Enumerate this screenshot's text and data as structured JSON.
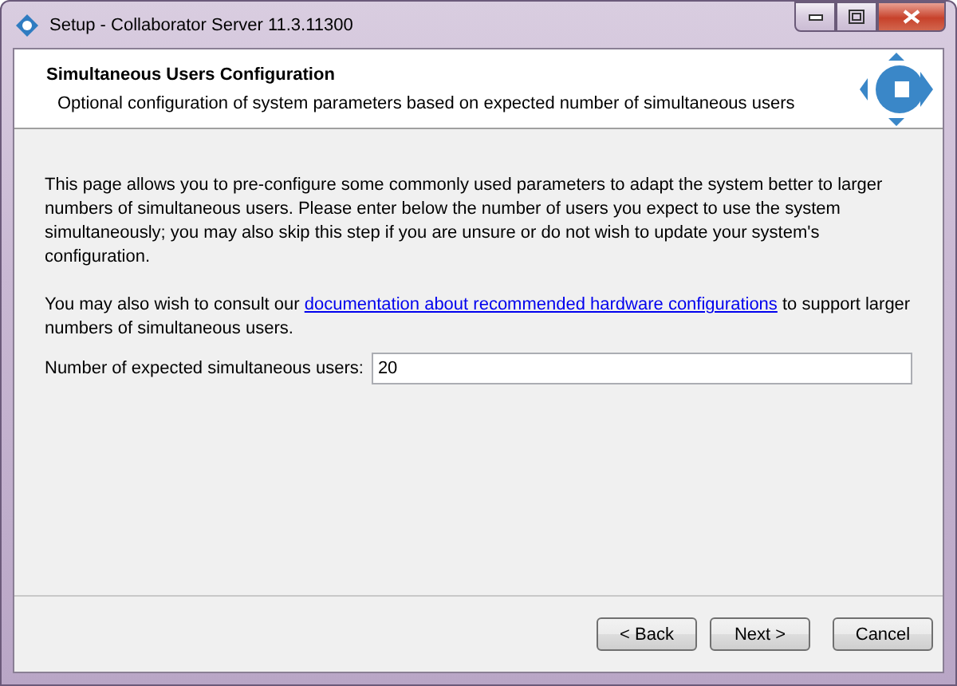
{
  "window": {
    "title": "Setup - Collaborator Server 11.3.11300"
  },
  "header": {
    "title": "Simultaneous Users Configuration",
    "subtitle": "Optional configuration of system parameters based on expected number of simultaneous users"
  },
  "intro": "This page allows you to pre-configure some commonly used parameters to adapt the system better to larger numbers of simultaneous users. Please enter below the number of users you expect to use the system simultaneously; you may also skip this step if you are unsure or do not wish to update your system's configuration.",
  "consult": {
    "before": "You may also wish to consult our ",
    "link": "documentation about recommended hardware configurations",
    "after": " to support larger numbers of simultaneous users."
  },
  "users_field": {
    "label": "Number of expected simultaneous users:",
    "value": "20"
  },
  "buttons": [
    "< Back",
    "Next >",
    "Cancel"
  ]
}
